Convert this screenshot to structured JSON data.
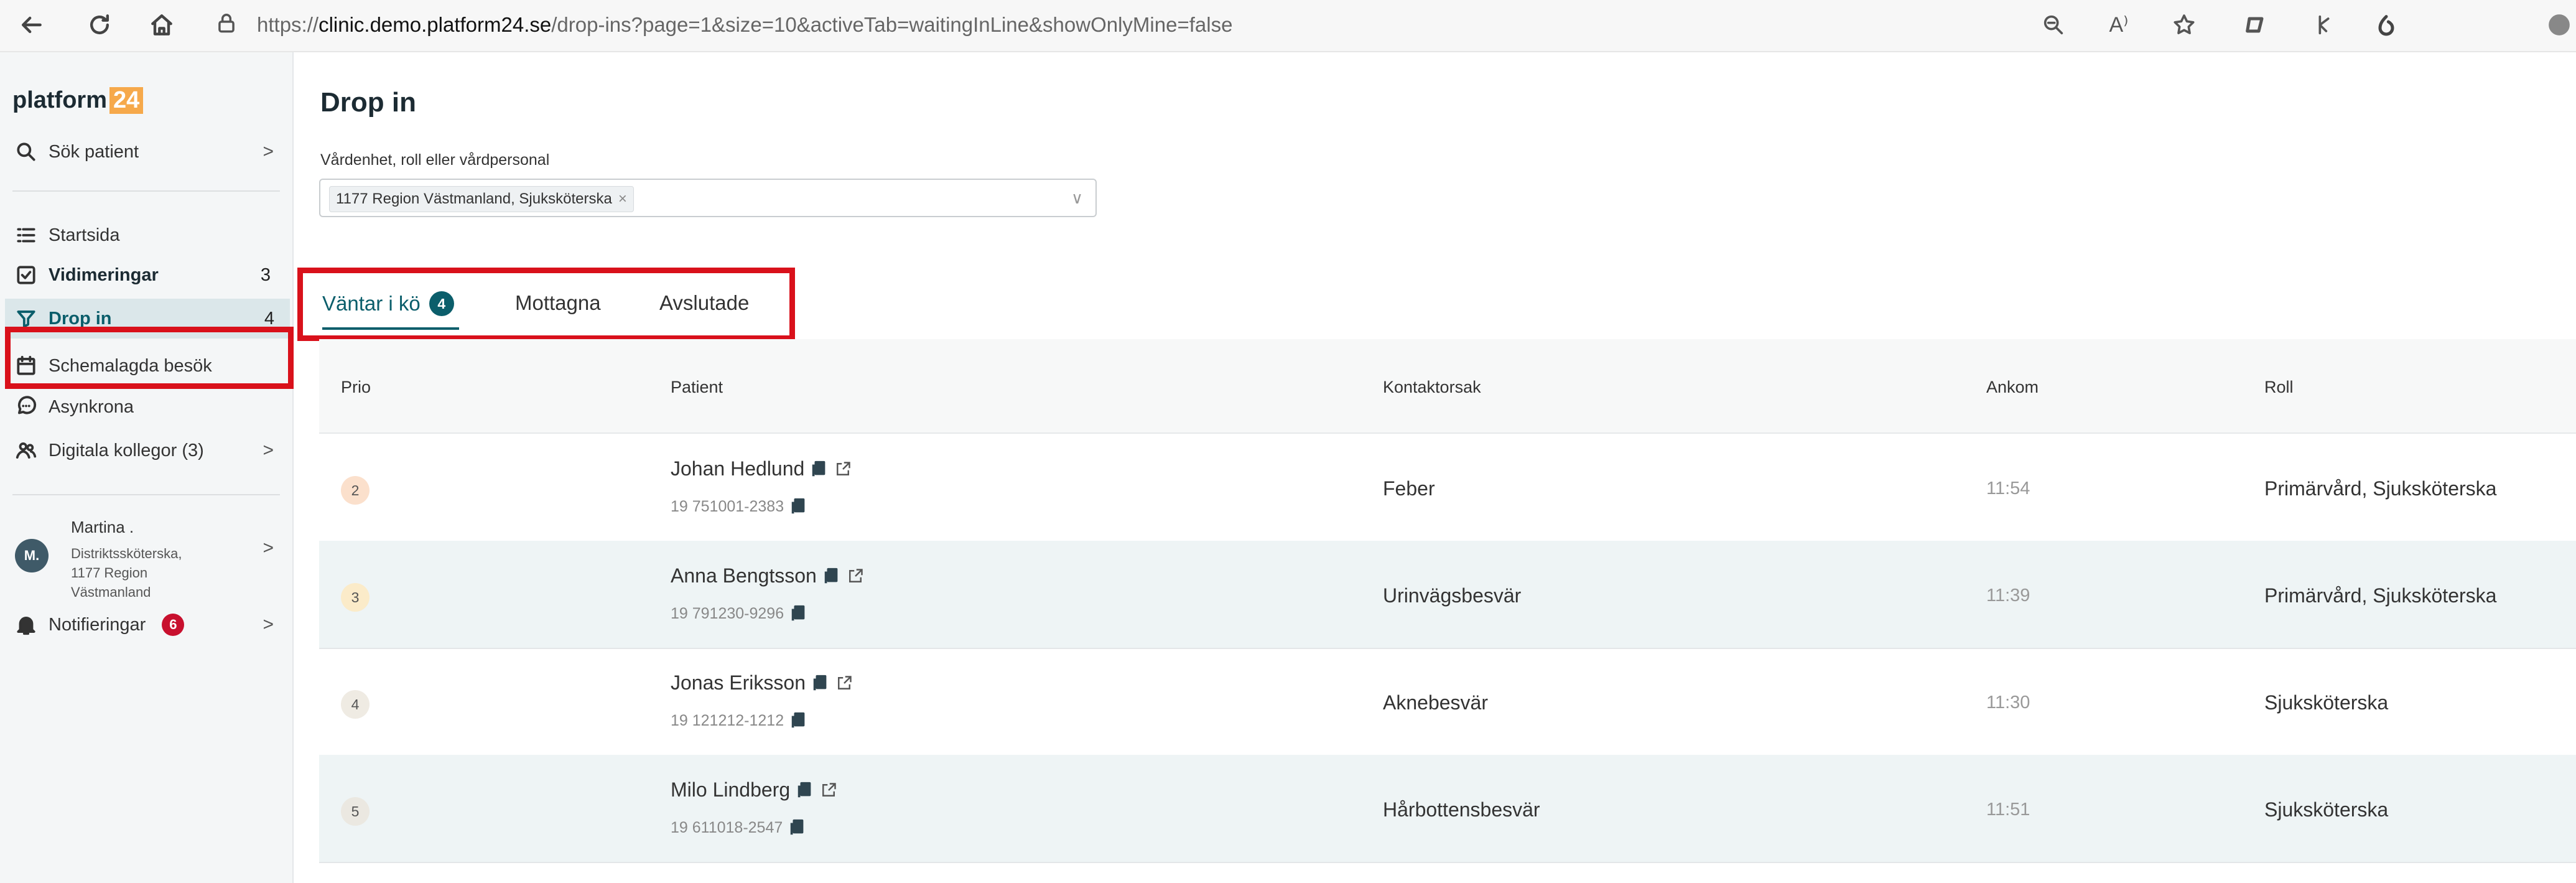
{
  "browser": {
    "url_prefix": "https://",
    "url_host": "clinic.demo.platform24.se",
    "url_path": "/drop-ins?page=1&size=10&activeTab=waitingInLine&showOnlyMine=false",
    "reader_label": "A⁾"
  },
  "sidebar": {
    "logo_text": "platform",
    "logo_num": "24",
    "search": {
      "label": "Sök patient",
      "chevron": ">"
    },
    "items": [
      {
        "label": "Startsida",
        "count": ""
      },
      {
        "label": "Vidimeringar",
        "count": "3"
      },
      {
        "label": "Drop in",
        "count": "4"
      },
      {
        "label": "Schemalagda besök",
        "count": ""
      },
      {
        "label": "Asynkrona",
        "count": ""
      },
      {
        "label": "Digitala kollegor (3)",
        "count": ""
      }
    ],
    "chevron": ">",
    "user": {
      "initials": "M.",
      "name": "Martina .",
      "role": "Distriktssköterska, 1177 Region Västmanland"
    },
    "notifications": {
      "label": "Notifieringar",
      "count": "6"
    }
  },
  "main": {
    "title": "Drop in",
    "filter": {
      "label": "Vårdenhet, roll eller vårdpersonal",
      "chip": "1177 Region Västmanland, Sjuksköterska",
      "chip_remove": "×",
      "dropdown": "∨"
    },
    "tabs": [
      {
        "label": "Väntar i kö",
        "badge": "4"
      },
      {
        "label": "Mottagna"
      },
      {
        "label": "Avslutade"
      }
    ],
    "table": {
      "headers": [
        "Prio",
        "Patient",
        "Kontaktorsak",
        "Ankom",
        "Roll"
      ],
      "rows": [
        {
          "prio": "2",
          "prio_color": "#fbe0cc",
          "name": "Johan Hedlund",
          "pnr": "19 751001-2383",
          "reason": "Feber",
          "time": "11:54",
          "role": "Primärvård, Sjuksköterska"
        },
        {
          "prio": "3",
          "prio_color": "#fbebc9",
          "name": "Anna Bengtsson",
          "pnr": "19 791230-9296",
          "reason": "Urinvägsbesvär",
          "time": "11:39",
          "role": "Primärvård, Sjuksköterska"
        },
        {
          "prio": "4",
          "prio_color": "#efebe3",
          "name": "Jonas Eriksson",
          "pnr": "19 121212-1212",
          "reason": "Aknebesvär",
          "time": "11:30",
          "role": "Sjuksköterska"
        },
        {
          "prio": "5",
          "prio_color": "#ebe8e1",
          "name": "Milo Lindberg",
          "pnr": "19 611018-2547",
          "reason": "Hårbottensbesvär",
          "time": "11:51",
          "role": "Sjuksköterska"
        }
      ]
    }
  },
  "colors": {
    "accent": "#0b5e6b",
    "highlight": "#d9111b",
    "notification": "#c8102e"
  }
}
